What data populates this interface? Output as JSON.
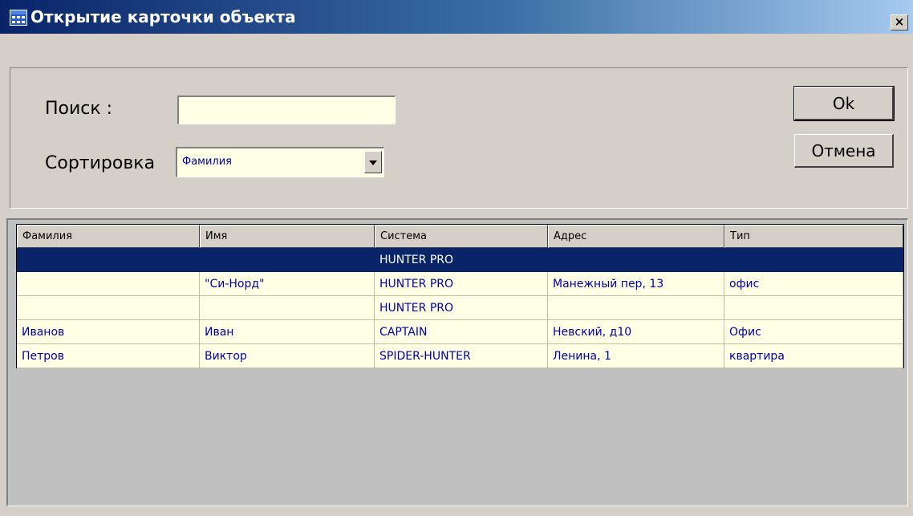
{
  "window": {
    "title": "Открытие карточки объекта",
    "close_label": "×"
  },
  "form": {
    "search_label": "Поиск :",
    "search_value": "",
    "sort_label": "Сортировка",
    "sort_value": "Фамилия"
  },
  "buttons": {
    "ok_label": "Ok",
    "cancel_label": "Отмена"
  },
  "grid": {
    "columns": [
      "Фамилия",
      "Имя",
      "Система",
      "Адрес",
      "Тип"
    ],
    "rows": [
      [
        "",
        "",
        "HUNTER PRO",
        "",
        ""
      ],
      [
        "",
        "\"Си-Норд\"",
        "HUNTER PRO",
        "Манежный пер, 13",
        "офис"
      ],
      [
        "",
        "",
        "HUNTER PRO",
        "",
        ""
      ],
      [
        "Иванов",
        "Иван",
        "CAPTAIN",
        "Невский, д10",
        "Офис"
      ],
      [
        "Петров",
        "Виктор",
        "SPIDER-HUNTER",
        "Ленина, 1",
        "квартира"
      ]
    ],
    "selected_row": 0
  },
  "colors": {
    "titlebar_start": "#0a246a",
    "titlebar_end": "#a6caf0",
    "selection": "#0a246a",
    "cell_background": "#ffffe6",
    "cell_text": "#0000aa",
    "window_background": "#d4d0c8"
  }
}
